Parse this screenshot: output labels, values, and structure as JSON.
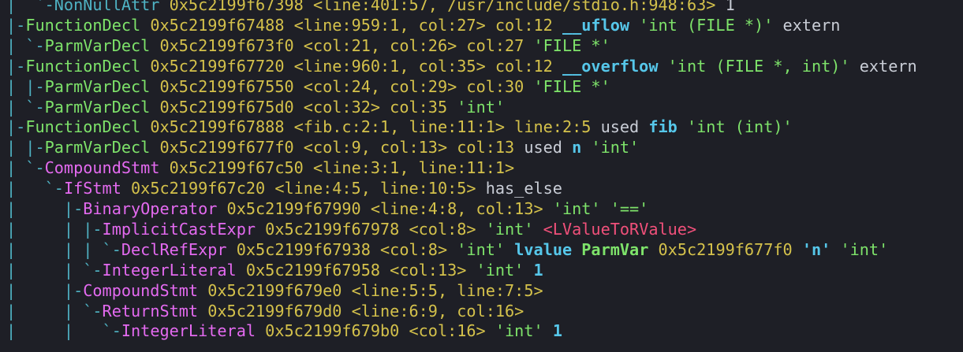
{
  "colors": {
    "background": "#1e1f26",
    "tree": "#4fb3c4",
    "decl_green": "#7ee36a",
    "stmt_magenta": "#e46af0",
    "address_yellow": "#d4c14b",
    "identifier_cyan": "#56c7ea",
    "cast_red": "#f0507a",
    "text": "#c9cdd6"
  },
  "lines": [
    {
      "segments": [
        {
          "c": "tree",
          "t": "|  `-NonNullAttr "
        },
        {
          "c": "addr",
          "t": "0x5c2199f67398 "
        },
        {
          "c": "loc",
          "t": "<line:401:57, /usr/include/stdio.h:948:63> "
        },
        {
          "c": "plain",
          "t": "1"
        }
      ]
    },
    {
      "segments": [
        {
          "c": "tree",
          "t": "|-"
        },
        {
          "c": "grn",
          "t": "FunctionDecl "
        },
        {
          "c": "addr",
          "t": "0x5c2199f67488 "
        },
        {
          "c": "loc",
          "t": "<line:959:1, col:27> col:12 "
        },
        {
          "c": "id",
          "t": "__uflow "
        },
        {
          "c": "str",
          "t": "'int (FILE *)' "
        },
        {
          "c": "plain",
          "t": "extern"
        }
      ]
    },
    {
      "segments": [
        {
          "c": "tree",
          "t": "| `-"
        },
        {
          "c": "grn",
          "t": "ParmVarDecl "
        },
        {
          "c": "addr",
          "t": "0x5c2199f673f0 "
        },
        {
          "c": "loc",
          "t": "<col:21, col:26> col:27 "
        },
        {
          "c": "str",
          "t": "'FILE *'"
        }
      ]
    },
    {
      "segments": [
        {
          "c": "tree",
          "t": "|-"
        },
        {
          "c": "grn",
          "t": "FunctionDecl "
        },
        {
          "c": "addr",
          "t": "0x5c2199f67720 "
        },
        {
          "c": "loc",
          "t": "<line:960:1, col:35> col:12 "
        },
        {
          "c": "id",
          "t": "__overflow "
        },
        {
          "c": "str",
          "t": "'int (FILE *, int)' "
        },
        {
          "c": "plain",
          "t": "extern"
        }
      ]
    },
    {
      "segments": [
        {
          "c": "tree",
          "t": "| |-"
        },
        {
          "c": "grn",
          "t": "ParmVarDecl "
        },
        {
          "c": "addr",
          "t": "0x5c2199f67550 "
        },
        {
          "c": "loc",
          "t": "<col:24, col:29> col:30 "
        },
        {
          "c": "str",
          "t": "'FILE *'"
        }
      ]
    },
    {
      "segments": [
        {
          "c": "tree",
          "t": "| `-"
        },
        {
          "c": "grn",
          "t": "ParmVarDecl "
        },
        {
          "c": "addr",
          "t": "0x5c2199f675d0 "
        },
        {
          "c": "loc",
          "t": "<col:32> col:35 "
        },
        {
          "c": "str",
          "t": "'int'"
        }
      ]
    },
    {
      "segments": [
        {
          "c": "tree",
          "t": "|-"
        },
        {
          "c": "grn",
          "t": "FunctionDecl "
        },
        {
          "c": "addr",
          "t": "0x5c2199f67888 "
        },
        {
          "c": "loc",
          "t": "<fib.c:2:1, line:11:1> line:2:5 "
        },
        {
          "c": "plain",
          "t": "used "
        },
        {
          "c": "id",
          "t": "fib "
        },
        {
          "c": "str",
          "t": "'int (int)'"
        }
      ]
    },
    {
      "segments": [
        {
          "c": "tree",
          "t": "| |-"
        },
        {
          "c": "grn",
          "t": "ParmVarDecl "
        },
        {
          "c": "addr",
          "t": "0x5c2199f677f0 "
        },
        {
          "c": "loc",
          "t": "<col:9, col:13> col:13 "
        },
        {
          "c": "plain",
          "t": "used "
        },
        {
          "c": "id",
          "t": "n "
        },
        {
          "c": "str",
          "t": "'int'"
        }
      ]
    },
    {
      "segments": [
        {
          "c": "tree",
          "t": "| `-"
        },
        {
          "c": "mag",
          "t": "CompoundStmt "
        },
        {
          "c": "addr",
          "t": "0x5c2199f67c50 "
        },
        {
          "c": "loc",
          "t": "<line:3:1, line:11:1>"
        }
      ]
    },
    {
      "segments": [
        {
          "c": "tree",
          "t": "|   `-"
        },
        {
          "c": "mag",
          "t": "IfStmt "
        },
        {
          "c": "addr",
          "t": "0x5c2199f67c20 "
        },
        {
          "c": "loc",
          "t": "<line:4:5, line:10:5> "
        },
        {
          "c": "plain",
          "t": "has_else"
        }
      ]
    },
    {
      "segments": [
        {
          "c": "tree",
          "t": "|     |-"
        },
        {
          "c": "mag",
          "t": "BinaryOperator "
        },
        {
          "c": "addr",
          "t": "0x5c2199f67990 "
        },
        {
          "c": "loc",
          "t": "<line:4:8, col:13> "
        },
        {
          "c": "str",
          "t": "'int' '=='"
        }
      ]
    },
    {
      "segments": [
        {
          "c": "tree",
          "t": "|     | |-"
        },
        {
          "c": "mag",
          "t": "ImplicitCastExpr "
        },
        {
          "c": "addr",
          "t": "0x5c2199f67978 "
        },
        {
          "c": "loc",
          "t": "<col:8> "
        },
        {
          "c": "str",
          "t": "'int' "
        },
        {
          "c": "red",
          "t": "<LValueToRValue>"
        }
      ]
    },
    {
      "segments": [
        {
          "c": "tree",
          "t": "|     | | `-"
        },
        {
          "c": "mag",
          "t": "DeclRefExpr "
        },
        {
          "c": "addr",
          "t": "0x5c2199f67938 "
        },
        {
          "c": "loc",
          "t": "<col:8> "
        },
        {
          "c": "str",
          "t": "'int' "
        },
        {
          "c": "id",
          "t": "lvalue "
        },
        {
          "c": "grnb",
          "t": "ParmVar "
        },
        {
          "c": "addr",
          "t": "0x5c2199f677f0 "
        },
        {
          "c": "id",
          "t": "'n' "
        },
        {
          "c": "str",
          "t": "'int'"
        }
      ]
    },
    {
      "segments": [
        {
          "c": "tree",
          "t": "|     | `-"
        },
        {
          "c": "mag",
          "t": "IntegerLiteral "
        },
        {
          "c": "addr",
          "t": "0x5c2199f67958 "
        },
        {
          "c": "loc",
          "t": "<col:13> "
        },
        {
          "c": "str",
          "t": "'int' "
        },
        {
          "c": "num",
          "t": "1"
        }
      ]
    },
    {
      "segments": [
        {
          "c": "tree",
          "t": "|     |-"
        },
        {
          "c": "mag",
          "t": "CompoundStmt "
        },
        {
          "c": "addr",
          "t": "0x5c2199f679e0 "
        },
        {
          "c": "loc",
          "t": "<line:5:5, line:7:5>"
        }
      ]
    },
    {
      "segments": [
        {
          "c": "tree",
          "t": "|     | `-"
        },
        {
          "c": "mag",
          "t": "ReturnStmt "
        },
        {
          "c": "addr",
          "t": "0x5c2199f679d0 "
        },
        {
          "c": "loc",
          "t": "<line:6:9, col:16>"
        }
      ]
    },
    {
      "segments": [
        {
          "c": "tree",
          "t": "|     |   `-"
        },
        {
          "c": "mag",
          "t": "IntegerLiteral "
        },
        {
          "c": "addr",
          "t": "0x5c2199f679b0 "
        },
        {
          "c": "loc",
          "t": "<col:16> "
        },
        {
          "c": "str",
          "t": "'int' "
        },
        {
          "c": "num",
          "t": "1"
        }
      ]
    }
  ]
}
